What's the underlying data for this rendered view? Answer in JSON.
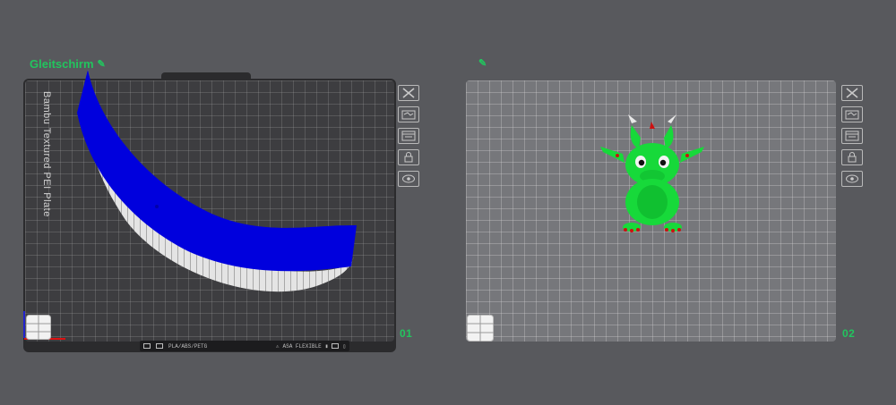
{
  "plates": [
    {
      "title": "Gleitschirm",
      "number": "01",
      "vertical_label": "Bambu Textured PEI Plate",
      "bottom_strip": {
        "filament_text": "PLA/ABS/PETG",
        "info_text": "ASA FLEXIBLE"
      },
      "model_name": "paraglider-wing",
      "model_colors": {
        "top": "#0000dd",
        "bottom": "#e6e6e6"
      }
    },
    {
      "title": "",
      "number": "02",
      "model_name": "dragon-figurine",
      "model_colors": {
        "body": "#17d93a",
        "horns": "#e8e8e8",
        "claws": "#cc1111"
      }
    }
  ],
  "toolbar_icons": [
    "close-icon",
    "auto-arrange-icon",
    "layout-icon",
    "lock-icon",
    "eye-icon"
  ],
  "colors": {
    "accent": "#22c55e",
    "background": "#58595d"
  }
}
